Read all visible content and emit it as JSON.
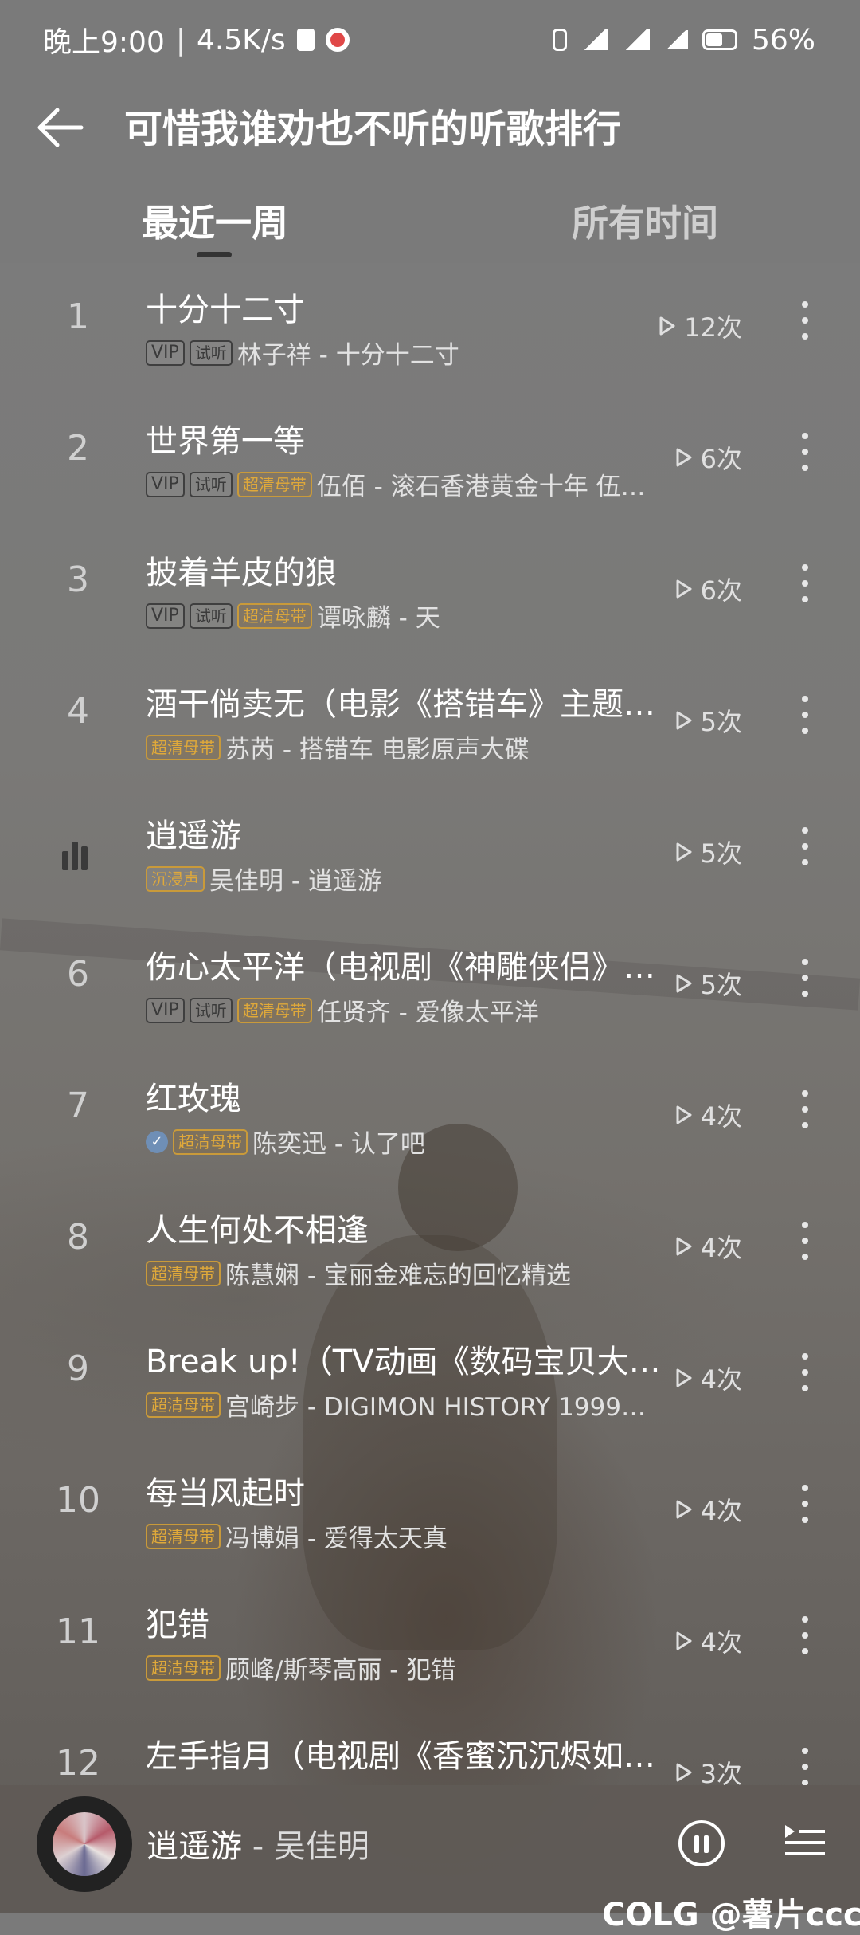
{
  "status_bar": {
    "time": "晚上9:00",
    "speed": "4.5K/s",
    "battery": "56%"
  },
  "header": {
    "title": "可惜我谁劝也不听的听歌排行",
    "back_icon": "back-arrow-icon"
  },
  "tabs": [
    {
      "label": "最近一周",
      "active": true
    },
    {
      "label": "所有时间",
      "active": false
    }
  ],
  "songs": [
    {
      "rank": "1",
      "title": "十分十二寸",
      "badges": [
        "VIP",
        "试听"
      ],
      "info": "林子祥 - 十分十二寸",
      "plays": "12次"
    },
    {
      "rank": "2",
      "title": "世界第一等",
      "badges": [
        "VIP",
        "试听",
        "超清母带"
      ],
      "info": "伍佰 - 滚石香港黄金十年 伍…",
      "plays": "6次"
    },
    {
      "rank": "3",
      "title": "披着羊皮的狼",
      "badges": [
        "VIP",
        "试听",
        "超清母带"
      ],
      "info": "谭咏麟 - 天",
      "plays": "6次"
    },
    {
      "rank": "4",
      "title": "酒干倘卖无（电影《搭错车》主题曲）",
      "badges": [
        "超清母带"
      ],
      "info": "苏芮 - 搭错车 电影原声大碟",
      "plays": "5次"
    },
    {
      "rank": "5",
      "title": "逍遥游",
      "badges": [
        "沉浸声"
      ],
      "info": "吴佳明 - 逍遥游",
      "plays": "5次",
      "playing": true
    },
    {
      "rank": "6",
      "title": "伤心太平洋（电视剧《神雕侠侣》…",
      "badges": [
        "VIP",
        "试听",
        "超清母带"
      ],
      "info": "任贤齐 - 爱像太平洋",
      "plays": "5次"
    },
    {
      "rank": "7",
      "title": "红玫瑰",
      "badges": [
        "✓",
        "超清母带"
      ],
      "info": "陈奕迅 - 认了吧",
      "plays": "4次"
    },
    {
      "rank": "8",
      "title": "人生何处不相逢",
      "badges": [
        "超清母带"
      ],
      "info": "陈慧娴 - 宝丽金难忘的回忆精选",
      "plays": "4次"
    },
    {
      "rank": "9",
      "title": "Break up!（TV动画《数码宝贝大冒…",
      "badges": [
        "超清母带"
      ],
      "info": "宫崎步 - DIGIMON HISTORY 1999…",
      "plays": "4次"
    },
    {
      "rank": "10",
      "title": "每当风起时",
      "badges": [
        "超清母带"
      ],
      "info": "冯博娟 - 爱得太天真",
      "plays": "4次"
    },
    {
      "rank": "11",
      "title": "犯错",
      "badges": [
        "超清母带"
      ],
      "info": "顾峰/斯琴高丽 - 犯错",
      "plays": "4次"
    },
    {
      "rank": "12",
      "title": "左手指月（电视剧《香蜜沉沉烬如…",
      "badges": [],
      "info": "",
      "plays": "3次"
    }
  ],
  "player": {
    "song": "逍遥游",
    "separator": " - ",
    "artist": "吴佳明"
  },
  "watermark": "COLG @薯片cccc"
}
